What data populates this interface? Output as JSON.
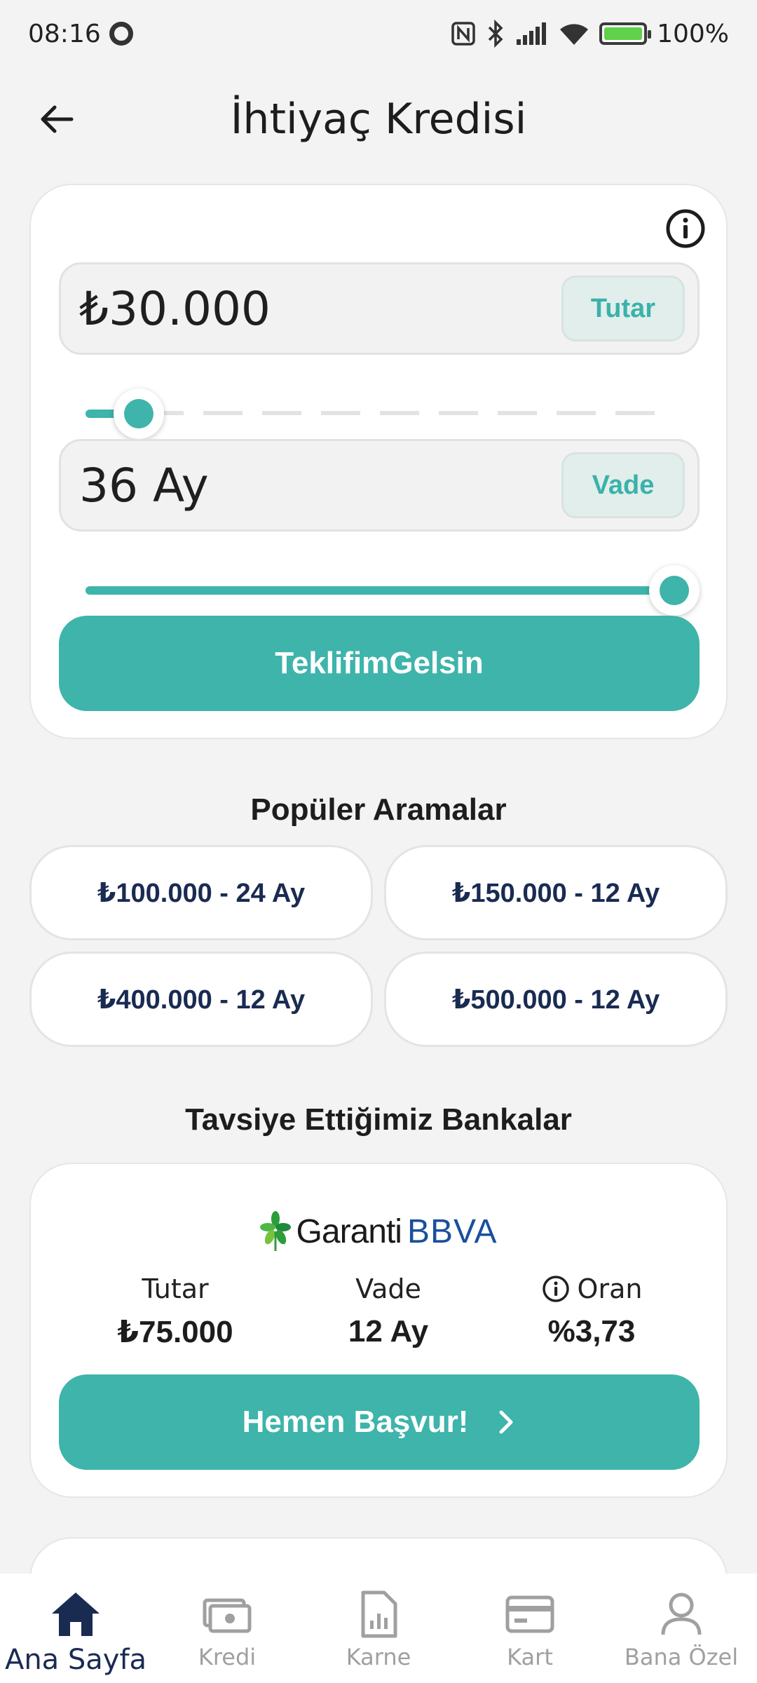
{
  "status_bar": {
    "time": "08:16",
    "battery": "100%",
    "battery_level": 1.0
  },
  "header": {
    "title": "İhtiyaç Kredisi"
  },
  "calculator": {
    "amount_value": "₺30.000",
    "amount_tag": "Tutar",
    "amount_slider_level": 0.09,
    "term_value": "36 Ay",
    "term_tag": "Vade",
    "term_slider_level": 1.0,
    "submit_label": "TeklifimGelsin"
  },
  "popular": {
    "title": "Popüler Aramalar",
    "items": [
      "₺100.000 - 24 Ay",
      "₺150.000 - 12 Ay",
      "₺400.000 - 12 Ay",
      "₺500.000 - 12 Ay"
    ]
  },
  "recommended": {
    "title": "Tavsiye Ettiğimiz Bankalar",
    "bank": {
      "logo_text_1": "Garanti",
      "logo_text_2": "BBVA",
      "amount_label": "Tutar",
      "amount_value": "₺75.000",
      "term_label": "Vade",
      "term_value": "12 Ay",
      "rate_label": "Oran",
      "rate_value": "%3,73",
      "apply_label": "Hemen Başvur!"
    }
  },
  "bottom_nav": {
    "items": [
      {
        "label": "Ana Sayfa",
        "icon": "home-icon",
        "active": true
      },
      {
        "label": "Kredi",
        "icon": "money-icon",
        "active": false
      },
      {
        "label": "Karne",
        "icon": "report-icon",
        "active": false
      },
      {
        "label": "Kart",
        "icon": "card-icon",
        "active": false
      },
      {
        "label": "Bana Özel",
        "icon": "user-icon",
        "active": false
      }
    ]
  },
  "colors": {
    "accent": "#3eb4ab",
    "navy": "#1a2b52",
    "background": "#f3f3f3"
  }
}
